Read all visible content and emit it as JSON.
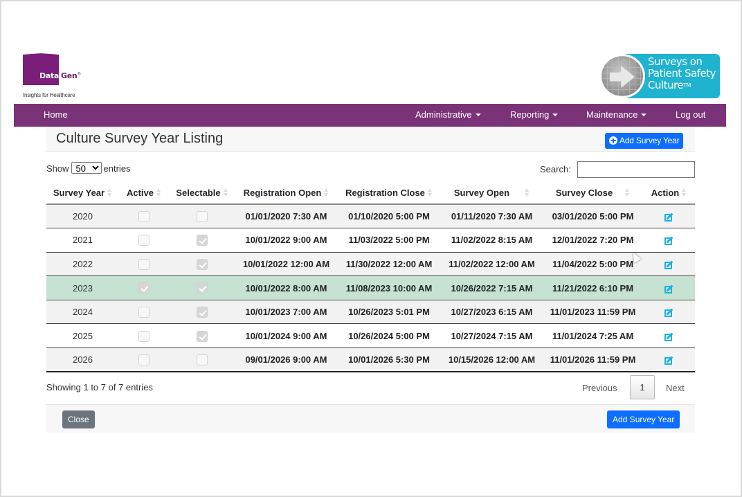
{
  "brand": {
    "left_logo": {
      "word1": "Data",
      "word2": "Gen",
      "reg": "®",
      "tagline": "Insights for Healthcare",
      "color": "#7a1e7a"
    },
    "right_logo": {
      "lines": [
        "Surveys on",
        "Patient Safety",
        "Culture"
      ],
      "tm": "TM",
      "color": "#1fb3d0"
    }
  },
  "navbar": {
    "color": "#7a3278",
    "home": "Home",
    "items": [
      {
        "label": "Administrative",
        "dropdown": true
      },
      {
        "label": "Reporting",
        "dropdown": true
      },
      {
        "label": "Maintenance",
        "dropdown": true
      },
      {
        "label": "Log out",
        "dropdown": false
      }
    ]
  },
  "page": {
    "title": "Culture Survey Year Listing",
    "add_button_label": "Add Survey Year"
  },
  "controls": {
    "show_label": "Show",
    "entries_label": "entries",
    "page_length": "50",
    "search_label": "Search:",
    "search_value": ""
  },
  "table": {
    "columns": [
      "Survey Year",
      "Active",
      "Selectable",
      "Registration Open",
      "Registration Close",
      "Survey Open",
      "Survey Close",
      "Action"
    ],
    "rows": [
      {
        "year": "2020",
        "active": false,
        "selectable": false,
        "reg_open": "01/01/2020 7:30 AM",
        "reg_close": "01/10/2020 5:00 PM",
        "survey_open": "01/11/2020 7:30 AM",
        "survey_close": "03/01/2020 5:00 PM",
        "highlight": false
      },
      {
        "year": "2021",
        "active": false,
        "selectable": true,
        "reg_open": "10/01/2022 9:00 AM",
        "reg_close": "11/03/2022 5:00 PM",
        "survey_open": "11/02/2022 8:15 AM",
        "survey_close": "12/01/2022 7:20 PM",
        "highlight": false
      },
      {
        "year": "2022",
        "active": false,
        "selectable": true,
        "reg_open": "10/01/2022 12:00 AM",
        "reg_close": "11/30/2022 12:00 AM",
        "survey_open": "11/02/2022 12:00 AM",
        "survey_close": "11/04/2022 5:00 PM",
        "highlight": false
      },
      {
        "year": "2023",
        "active": true,
        "selectable": true,
        "reg_open": "10/01/2022 8:00 AM",
        "reg_close": "11/08/2023 10:00 AM",
        "survey_open": "10/26/2022 7:15 AM",
        "survey_close": "11/21/2022 6:10 PM",
        "highlight": true
      },
      {
        "year": "2024",
        "active": false,
        "selectable": true,
        "reg_open": "10/01/2023 7:00 AM",
        "reg_close": "10/26/2023 5:01 PM",
        "survey_open": "10/27/2023 6:15 AM",
        "survey_close": "11/01/2023 11:59 PM",
        "highlight": false
      },
      {
        "year": "2025",
        "active": false,
        "selectable": true,
        "reg_open": "10/01/2024 9:00 AM",
        "reg_close": "10/26/2024 5:00 PM",
        "survey_open": "10/27/2024 7:15 AM",
        "survey_close": "11/01/2024 7:25 AM",
        "highlight": false
      },
      {
        "year": "2026",
        "active": false,
        "selectable": false,
        "reg_open": "09/01/2026 9:00 AM",
        "reg_close": "10/01/2026 5:30 PM",
        "survey_open": "10/15/2026 12:00 AM",
        "survey_close": "11/01/2026 11:59 PM",
        "highlight": false
      }
    ],
    "action_icon": "edit-icon",
    "highlight_color": "#c5e2d3"
  },
  "footer": {
    "info": "Showing 1 to 7 of 7 entries",
    "previous": "Previous",
    "current_page": "1",
    "next": "Next",
    "close_label": "Close",
    "add_label": "Add Survey Year"
  }
}
